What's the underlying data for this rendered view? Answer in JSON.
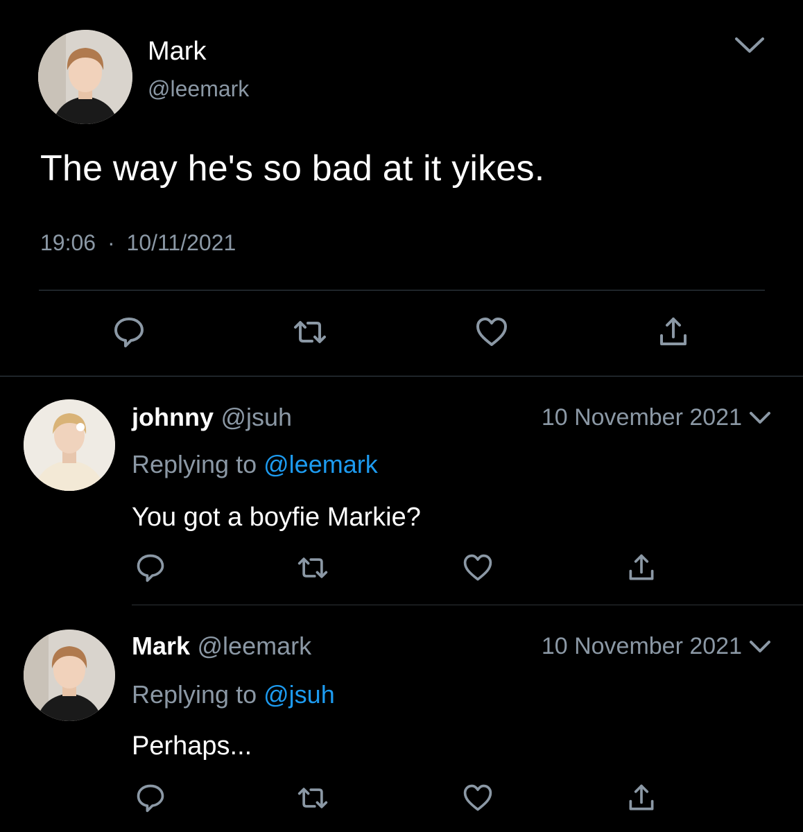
{
  "main_tweet": {
    "name": "Mark",
    "handle": "@leemark",
    "text": "The way he's so bad at it yikes.",
    "time": "19:06",
    "separator": "·",
    "date": "10/11/2021"
  },
  "replies": [
    {
      "name": "johnny",
      "handle": "@jsuh",
      "date": "10 November 2021",
      "replying_prefix": "Replying to",
      "replying_to": "@leemark",
      "text": "You got a boyfie Markie?"
    },
    {
      "name": "Mark",
      "handle": "@leemark",
      "date": "10 November 2021",
      "replying_prefix": "Replying to",
      "replying_to": "@jsuh",
      "text": "Perhaps..."
    }
  ],
  "icons": {
    "reply": "reply-icon",
    "retweet": "retweet-icon",
    "like": "heart-icon",
    "share": "share-icon",
    "menu": "chevron-down-icon"
  },
  "colors": {
    "background": "#000000",
    "text_primary": "#ffffff",
    "text_secondary": "#8b98a5",
    "link": "#1d9bf0",
    "icon": "#8b98a5",
    "divider": "#38444d"
  }
}
